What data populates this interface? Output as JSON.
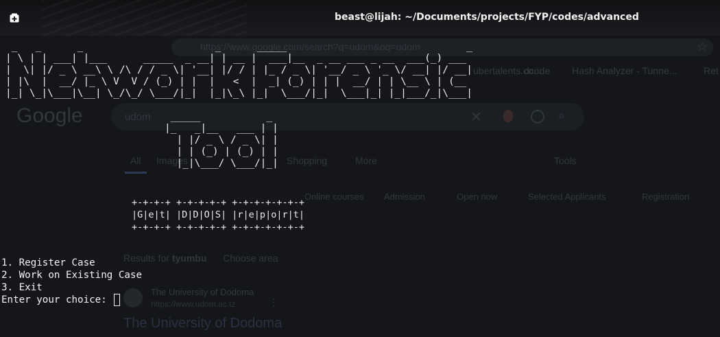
{
  "window": {
    "title": "beast@lijah: ~/Documents/projects/FYP/codes/advanced",
    "new_tab_icon": "new-tab-icon"
  },
  "background": {
    "url": "https://www.google.com/search?q=udom&oq=udom",
    "bookmarks": [
      "ubertalents.co...",
      "dcode",
      "Hash Analyzer - Tunne...",
      "Ret"
    ],
    "logo": "Google",
    "query": "udom",
    "tabs": [
      "All",
      "Images",
      "Shopping",
      "More",
      "Tools"
    ],
    "chips": [
      "Online courses",
      "Admission",
      "Open now",
      "Selected Applicants",
      "Registration"
    ],
    "results_prefix": "Results for",
    "results_place": "tyumbu",
    "choose_area": "Choose area",
    "site_name": "The University of Dodoma",
    "site_url": "https://www.udom.ac.tz",
    "result_title": "The University of Dodoma"
  },
  "terminal": {
    "banner_ascii": " _   _      _                      _      _____                              _\n| \\ | | ___| |___      _____  _ __| | __ |  ___|__  _ __ ___ _ __  ___(_) ___\n|  \\| |/ _ \\ __\\ \\ /\\ / / _ \\| '__| |/ / | |_ / _ \\| '__/ _ \\ '_ \\/ __| |/ __|\n| |\\  |  __/ |_ \\ V  V / (_) | |  |   <  |  _| (_) | | |  __/ | | \\__ \\ | (__\n|_| \\_|\\___|\\__| \\_/\\_/ \\___/|_|  |_|\\_\\ |_|  \\___/|_|  \\___|_| |_|___/_|\\___|",
    "tool_ascii": " _____           _\n|_   _|__   ___ | |\n  | |/ _ \\ / _ \\| |\n  | | (_) | (_) | |\n  |_|\\___/ \\___/|_|",
    "box_ascii": "+-+-+-+ +-+-+-+-+ +-+-+-+-+-+-+\n|G|e|t| |D|D|O|S| |r|e|p|o|r|t|\n+-+-+-+ +-+-+-+-+ +-+-+-+-+-+-+",
    "menu": [
      "1. Register Case",
      "2. Work on Existing Case",
      "3. Exit"
    ],
    "prompt": "Enter your choice: "
  }
}
